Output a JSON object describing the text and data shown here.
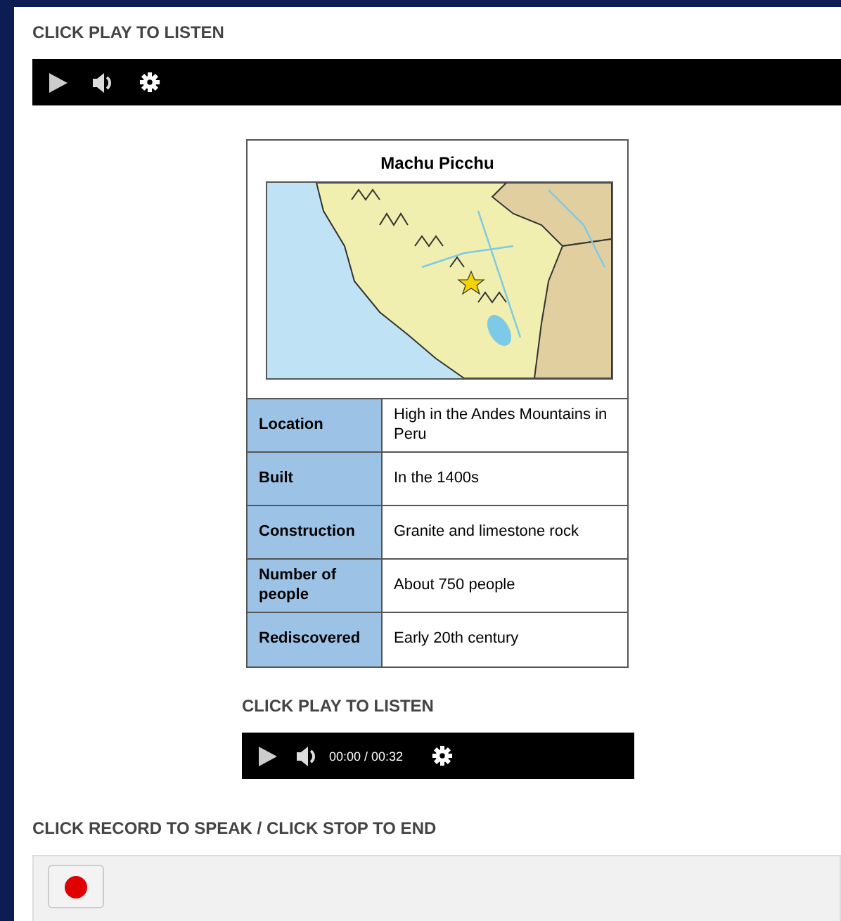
{
  "listen_section": {
    "label": "CLICK PLAY TO LISTEN",
    "player": {
      "controls": [
        {
          "kind": "play"
        },
        {
          "kind": "volume"
        },
        {
          "kind": "settings"
        }
      ]
    }
  },
  "figure": {
    "title": "Machu Picchu",
    "rows": [
      {
        "label": "Location",
        "value": "High in the Andes Mountains in Peru"
      },
      {
        "label": "Built",
        "value": "In the 1400s"
      },
      {
        "label": "Construction",
        "value": "Granite and limestone rock"
      },
      {
        "label": "Number of people",
        "value": "About 750 people"
      },
      {
        "label": "Rediscovered",
        "value": "Early 20th century"
      }
    ]
  },
  "figure_audio": {
    "label": "CLICK PLAY TO LISTEN",
    "player": {
      "controls": [
        {
          "kind": "play"
        },
        {
          "kind": "volume"
        },
        {
          "kind": "time"
        },
        {
          "kind": "settings"
        }
      ],
      "current_time": "00:00",
      "separator": "/",
      "duration": "00:32"
    }
  },
  "record_section": {
    "label": "CLICK RECORD TO SPEAK / CLICK STOP TO END",
    "buttons": [
      {
        "kind": "record"
      }
    ]
  }
}
